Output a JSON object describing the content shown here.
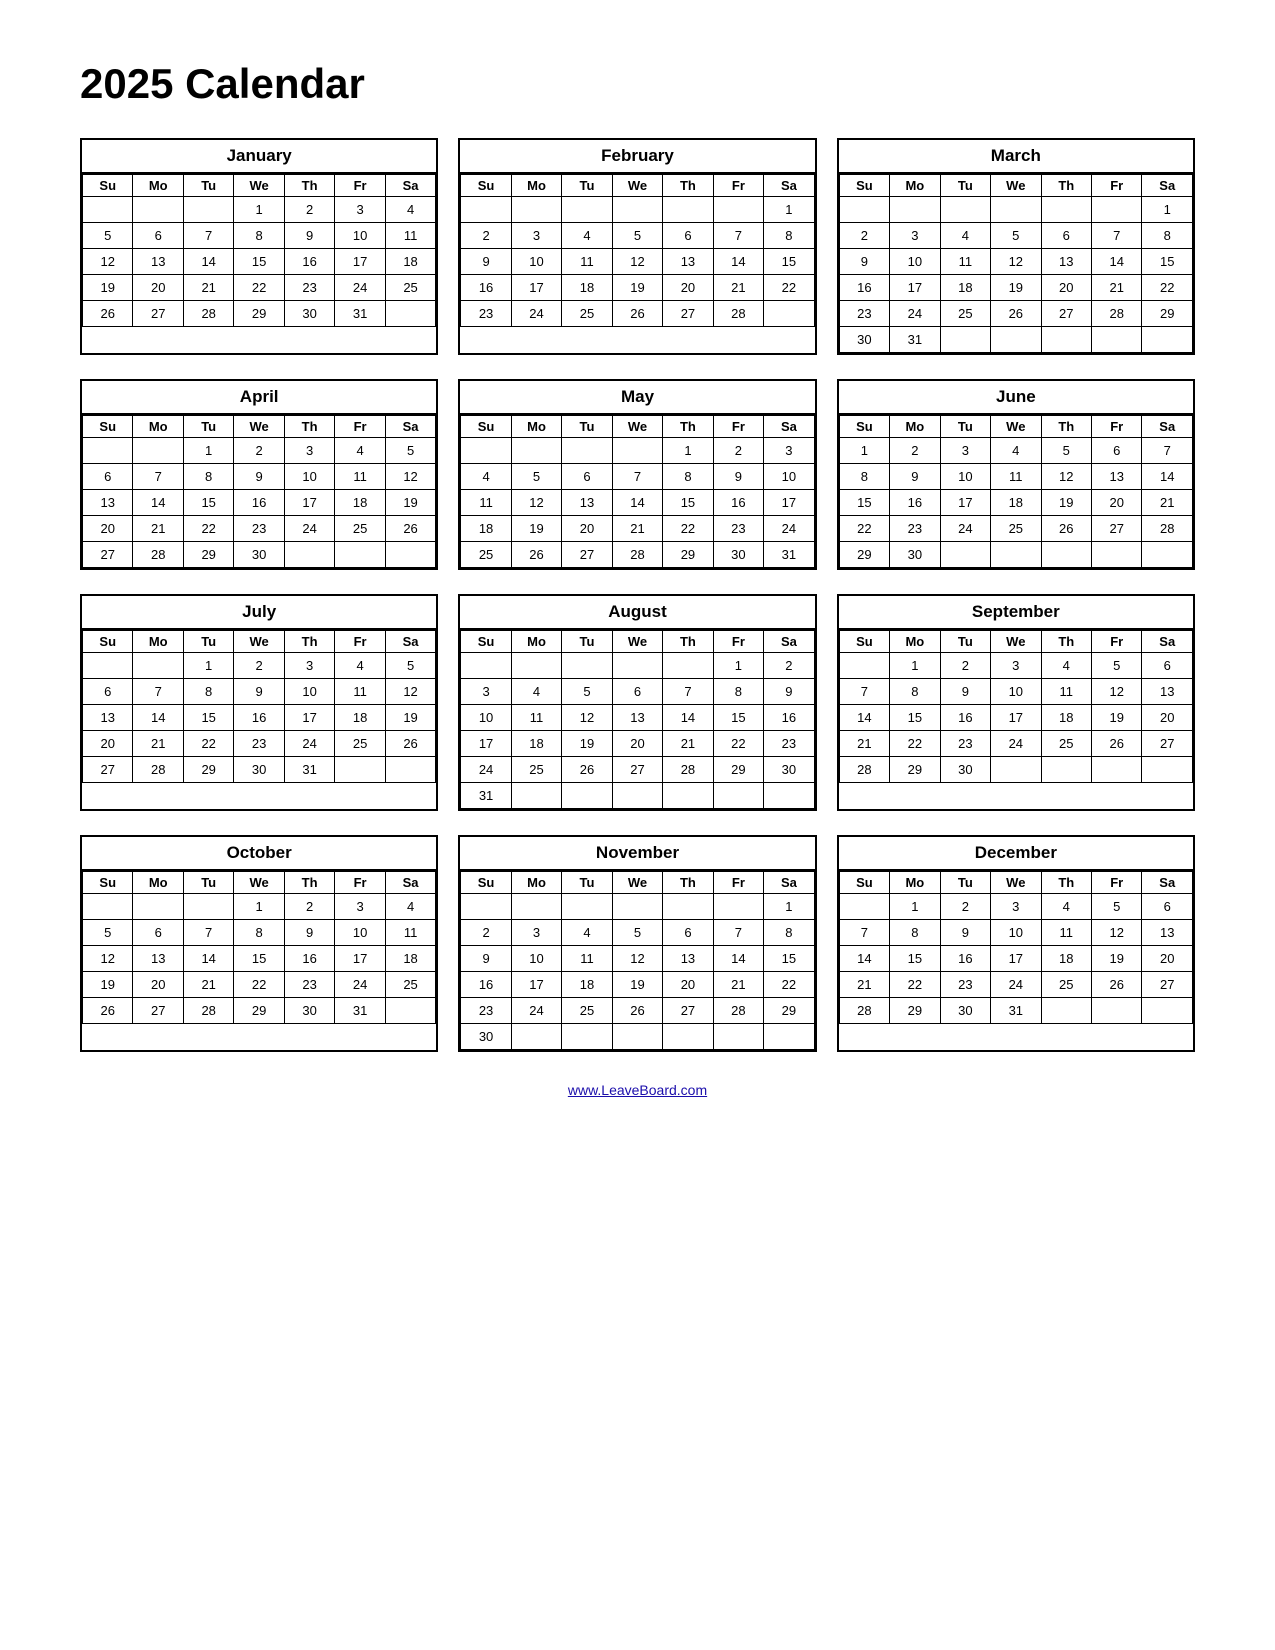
{
  "title": "2025 Calendar",
  "footer_link": "www.LeaveBoard.com",
  "days_header": [
    "Su",
    "Mo",
    "Tu",
    "We",
    "Th",
    "Fr",
    "Sa"
  ],
  "months": [
    {
      "name": "January",
      "weeks": [
        [
          "",
          "",
          "",
          "1",
          "2",
          "3",
          "4"
        ],
        [
          "5",
          "6",
          "7",
          "8",
          "9",
          "10",
          "11"
        ],
        [
          "12",
          "13",
          "14",
          "15",
          "16",
          "17",
          "18"
        ],
        [
          "19",
          "20",
          "21",
          "22",
          "23",
          "24",
          "25"
        ],
        [
          "26",
          "27",
          "28",
          "29",
          "30",
          "31",
          ""
        ]
      ]
    },
    {
      "name": "February",
      "weeks": [
        [
          "",
          "",
          "",
          "",
          "",
          "",
          "1"
        ],
        [
          "2",
          "3",
          "4",
          "5",
          "6",
          "7",
          "8"
        ],
        [
          "9",
          "10",
          "11",
          "12",
          "13",
          "14",
          "15"
        ],
        [
          "16",
          "17",
          "18",
          "19",
          "20",
          "21",
          "22"
        ],
        [
          "23",
          "24",
          "25",
          "26",
          "27",
          "28",
          ""
        ]
      ]
    },
    {
      "name": "March",
      "weeks": [
        [
          "",
          "",
          "",
          "",
          "",
          "",
          "1"
        ],
        [
          "2",
          "3",
          "4",
          "5",
          "6",
          "7",
          "8"
        ],
        [
          "9",
          "10",
          "11",
          "12",
          "13",
          "14",
          "15"
        ],
        [
          "16",
          "17",
          "18",
          "19",
          "20",
          "21",
          "22"
        ],
        [
          "23",
          "24",
          "25",
          "26",
          "27",
          "28",
          "29"
        ],
        [
          "30",
          "31",
          "",
          "",
          "",
          "",
          ""
        ]
      ]
    },
    {
      "name": "April",
      "weeks": [
        [
          "",
          "",
          "1",
          "2",
          "3",
          "4",
          "5"
        ],
        [
          "6",
          "7",
          "8",
          "9",
          "10",
          "11",
          "12"
        ],
        [
          "13",
          "14",
          "15",
          "16",
          "17",
          "18",
          "19"
        ],
        [
          "20",
          "21",
          "22",
          "23",
          "24",
          "25",
          "26"
        ],
        [
          "27",
          "28",
          "29",
          "30",
          "",
          "",
          ""
        ]
      ]
    },
    {
      "name": "May",
      "weeks": [
        [
          "",
          "",
          "",
          "",
          "1",
          "2",
          "3"
        ],
        [
          "4",
          "5",
          "6",
          "7",
          "8",
          "9",
          "10"
        ],
        [
          "11",
          "12",
          "13",
          "14",
          "15",
          "16",
          "17"
        ],
        [
          "18",
          "19",
          "20",
          "21",
          "22",
          "23",
          "24"
        ],
        [
          "25",
          "26",
          "27",
          "28",
          "29",
          "30",
          "31"
        ]
      ]
    },
    {
      "name": "June",
      "weeks": [
        [
          "1",
          "2",
          "3",
          "4",
          "5",
          "6",
          "7"
        ],
        [
          "8",
          "9",
          "10",
          "11",
          "12",
          "13",
          "14"
        ],
        [
          "15",
          "16",
          "17",
          "18",
          "19",
          "20",
          "21"
        ],
        [
          "22",
          "23",
          "24",
          "25",
          "26",
          "27",
          "28"
        ],
        [
          "29",
          "30",
          "",
          "",
          "",
          "",
          ""
        ]
      ]
    },
    {
      "name": "July",
      "weeks": [
        [
          "",
          "",
          "1",
          "2",
          "3",
          "4",
          "5"
        ],
        [
          "6",
          "7",
          "8",
          "9",
          "10",
          "11",
          "12"
        ],
        [
          "13",
          "14",
          "15",
          "16",
          "17",
          "18",
          "19"
        ],
        [
          "20",
          "21",
          "22",
          "23",
          "24",
          "25",
          "26"
        ],
        [
          "27",
          "28",
          "29",
          "30",
          "31",
          "",
          ""
        ]
      ]
    },
    {
      "name": "August",
      "weeks": [
        [
          "",
          "",
          "",
          "",
          "",
          "1",
          "2"
        ],
        [
          "3",
          "4",
          "5",
          "6",
          "7",
          "8",
          "9"
        ],
        [
          "10",
          "11",
          "12",
          "13",
          "14",
          "15",
          "16"
        ],
        [
          "17",
          "18",
          "19",
          "20",
          "21",
          "22",
          "23"
        ],
        [
          "24",
          "25",
          "26",
          "27",
          "28",
          "29",
          "30"
        ],
        [
          "31",
          "",
          "",
          "",
          "",
          "",
          ""
        ]
      ]
    },
    {
      "name": "September",
      "weeks": [
        [
          "",
          "1",
          "2",
          "3",
          "4",
          "5",
          "6"
        ],
        [
          "7",
          "8",
          "9",
          "10",
          "11",
          "12",
          "13"
        ],
        [
          "14",
          "15",
          "16",
          "17",
          "18",
          "19",
          "20"
        ],
        [
          "21",
          "22",
          "23",
          "24",
          "25",
          "26",
          "27"
        ],
        [
          "28",
          "29",
          "30",
          "",
          "",
          "",
          ""
        ]
      ]
    },
    {
      "name": "October",
      "weeks": [
        [
          "",
          "",
          "",
          "1",
          "2",
          "3",
          "4"
        ],
        [
          "5",
          "6",
          "7",
          "8",
          "9",
          "10",
          "11"
        ],
        [
          "12",
          "13",
          "14",
          "15",
          "16",
          "17",
          "18"
        ],
        [
          "19",
          "20",
          "21",
          "22",
          "23",
          "24",
          "25"
        ],
        [
          "26",
          "27",
          "28",
          "29",
          "30",
          "31",
          ""
        ]
      ]
    },
    {
      "name": "November",
      "weeks": [
        [
          "",
          "",
          "",
          "",
          "",
          "",
          "1"
        ],
        [
          "2",
          "3",
          "4",
          "5",
          "6",
          "7",
          "8"
        ],
        [
          "9",
          "10",
          "11",
          "12",
          "13",
          "14",
          "15"
        ],
        [
          "16",
          "17",
          "18",
          "19",
          "20",
          "21",
          "22"
        ],
        [
          "23",
          "24",
          "25",
          "26",
          "27",
          "28",
          "29"
        ],
        [
          "30",
          "",
          "",
          "",
          "",
          "",
          ""
        ]
      ]
    },
    {
      "name": "December",
      "weeks": [
        [
          "",
          "1",
          "2",
          "3",
          "4",
          "5",
          "6"
        ],
        [
          "7",
          "8",
          "9",
          "10",
          "11",
          "12",
          "13"
        ],
        [
          "14",
          "15",
          "16",
          "17",
          "18",
          "19",
          "20"
        ],
        [
          "21",
          "22",
          "23",
          "24",
          "25",
          "26",
          "27"
        ],
        [
          "28",
          "29",
          "30",
          "31",
          "",
          "",
          ""
        ]
      ]
    }
  ]
}
